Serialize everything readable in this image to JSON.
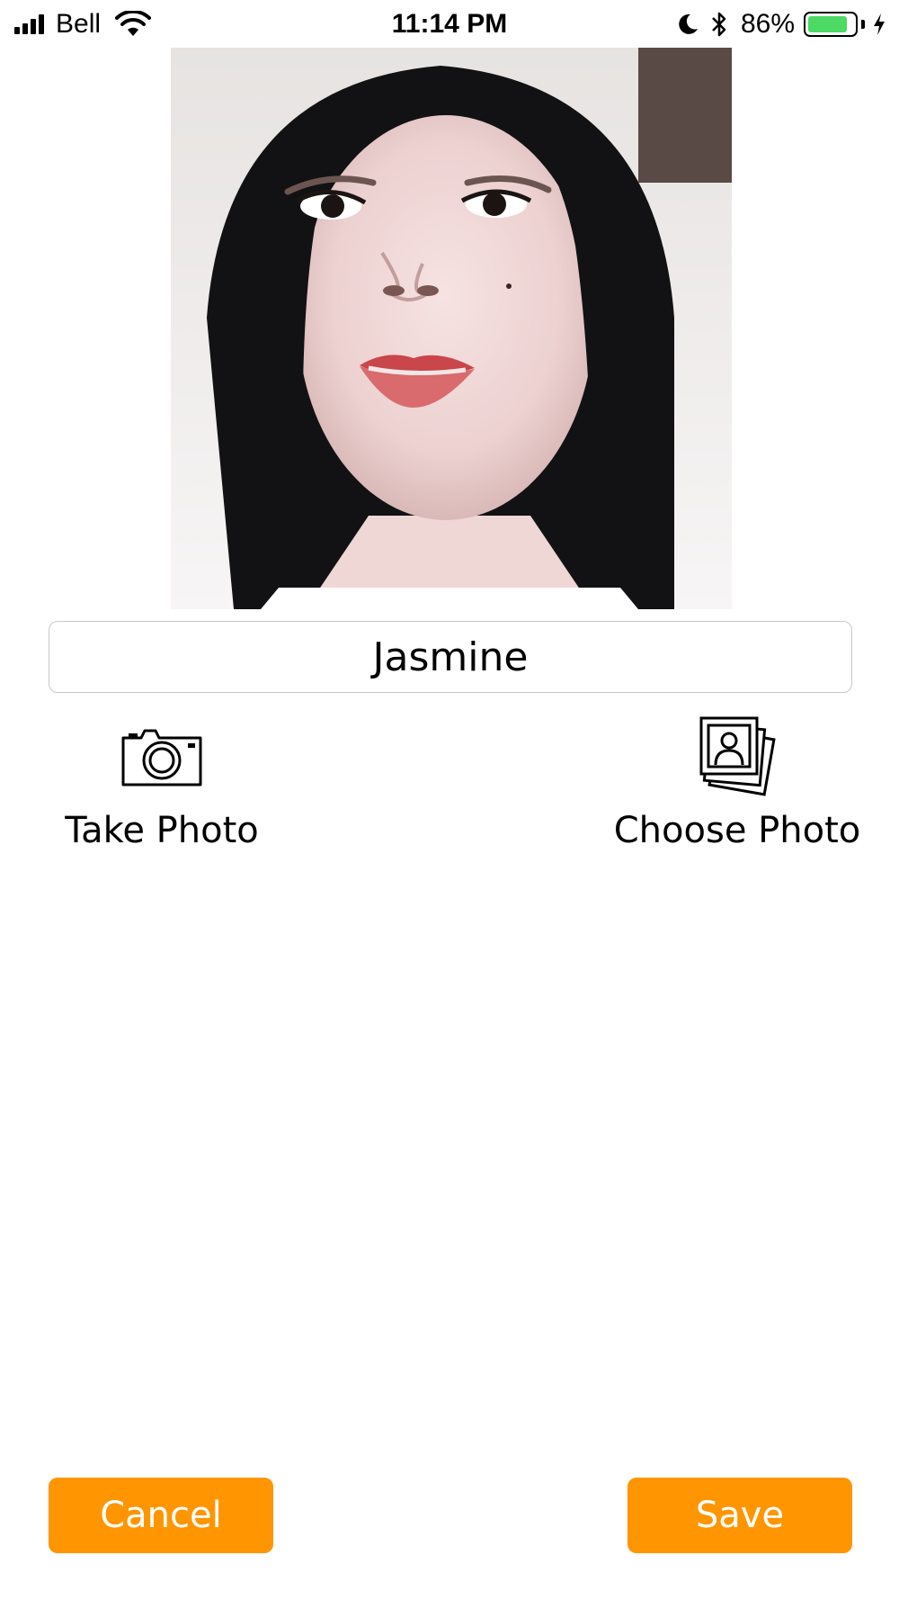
{
  "status_bar": {
    "carrier": "Bell",
    "time": "11:14 PM",
    "battery_percent_text": "86%",
    "battery_level": 0.86,
    "battery_color": "#4cd964",
    "icons": [
      "signal-icon",
      "wifi-icon",
      "moon-icon",
      "bluetooth-icon",
      "battery-icon",
      "charging-bolt-icon"
    ]
  },
  "profile": {
    "name_value": "Jasmine",
    "photo": "portrait-photo"
  },
  "actions": {
    "take_photo_label": "Take Photo",
    "take_photo_icon": "camera-icon",
    "choose_photo_label": "Choose Photo",
    "choose_photo_icon": "photo-stack-icon"
  },
  "buttons": {
    "cancel_label": "Cancel",
    "save_label": "Save",
    "accent_color": "#ff9500"
  }
}
